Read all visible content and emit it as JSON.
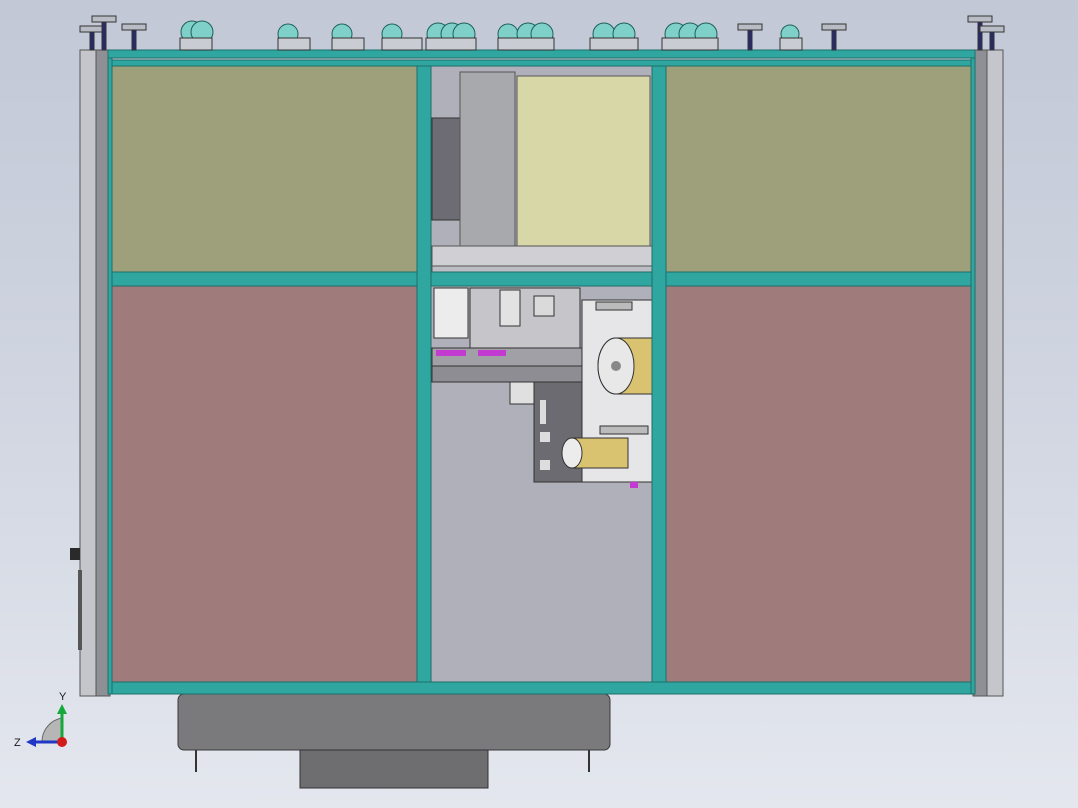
{
  "viewport": {
    "background_top": "#c2c8d6",
    "background_bottom": "#e4e7ee"
  },
  "colors": {
    "frame": "#2fa6a0",
    "frame_dark": "#1e6e6a",
    "upper_panel": "#9da07a",
    "lower_panel": "#9f7b7b",
    "center_opening": "#b0b0ba",
    "upper_center_panel": "#d8d7a8",
    "gray_panel": "#6d6b73",
    "side_post": "#c4c6cc",
    "base_cabinet": "#7a7a7c",
    "roller": "#d9c270",
    "accent_magenta": "#c23ad0"
  },
  "triad": {
    "y_label": "Y",
    "z_label": "Z",
    "y_axis_color": "#15a83a",
    "z_axis_color": "#1f38c7",
    "origin_color": "#d11a1a"
  }
}
